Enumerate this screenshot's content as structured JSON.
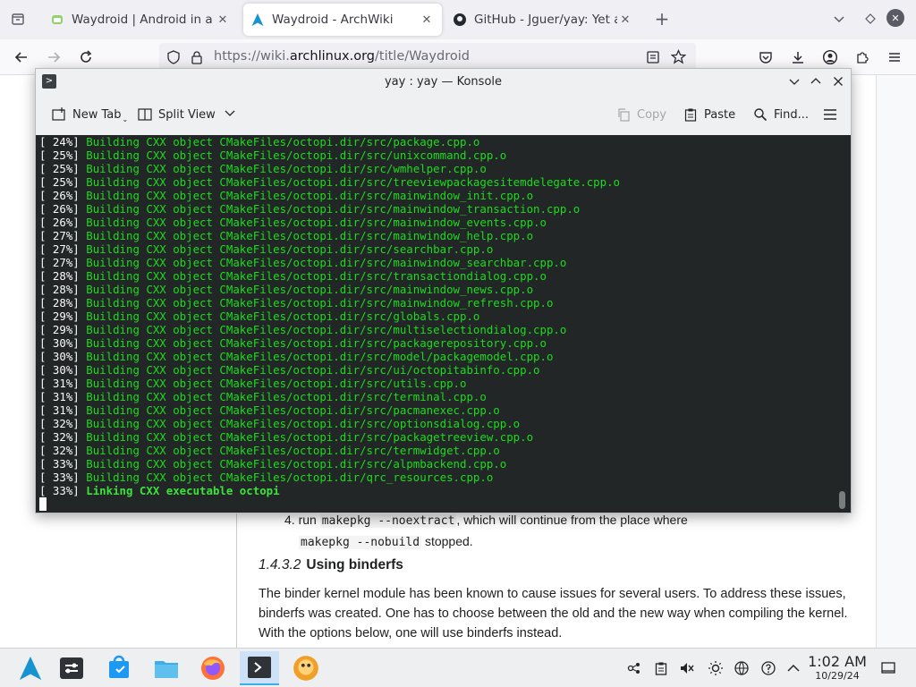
{
  "browser": {
    "tabs": [
      {
        "label": "Waydroid | Android in a Li",
        "icon": "waydroid-favicon",
        "active": false
      },
      {
        "label": "Waydroid - ArchWiki",
        "icon": "archlinux-favicon",
        "active": true
      },
      {
        "label": "GitHub - Jguer/yay: Yet ano",
        "icon": "github-favicon",
        "active": false
      }
    ],
    "url_prefix": "https://wiki.",
    "url_domain": "archlinux.org",
    "url_path": "/title/Waydroid"
  },
  "wiki": {
    "list_item_number": "4.",
    "list_item_run": "run",
    "code_noextract": "makepkg --noextract",
    "list_item_text1": ", which will continue from the place where",
    "code_nobuild": "makepkg --nobuild",
    "list_item_text2": " stopped.",
    "section_number": "1.4.3.2",
    "section_title": "Using binderfs",
    "paragraph": "The binder kernel module has been known to cause issues for several users. To address these issues, binderfs was created. One has to choose between the old and the new way when compiling the kernel. With the options below, one will use binderfs instead."
  },
  "konsole": {
    "title": "yay : yay — Konsole",
    "toolbar": {
      "new_tab": "New Tab",
      "split_view": "Split View",
      "copy": "Copy",
      "paste": "Paste",
      "find": "Find..."
    },
    "lines": [
      {
        "pct": "[ 24%]",
        "msg": "Building CXX object CMakeFiles/octopi.dir/src/package.cpp.o"
      },
      {
        "pct": "[ 25%]",
        "msg": "Building CXX object CMakeFiles/octopi.dir/src/unixcommand.cpp.o"
      },
      {
        "pct": "[ 25%]",
        "msg": "Building CXX object CMakeFiles/octopi.dir/src/wmhelper.cpp.o"
      },
      {
        "pct": "[ 25%]",
        "msg": "Building CXX object CMakeFiles/octopi.dir/src/treeviewpackagesitemdelegate.cpp.o"
      },
      {
        "pct": "[ 26%]",
        "msg": "Building CXX object CMakeFiles/octopi.dir/src/mainwindow_init.cpp.o"
      },
      {
        "pct": "[ 26%]",
        "msg": "Building CXX object CMakeFiles/octopi.dir/src/mainwindow_transaction.cpp.o"
      },
      {
        "pct": "[ 26%]",
        "msg": "Building CXX object CMakeFiles/octopi.dir/src/mainwindow_events.cpp.o"
      },
      {
        "pct": "[ 27%]",
        "msg": "Building CXX object CMakeFiles/octopi.dir/src/mainwindow_help.cpp.o"
      },
      {
        "pct": "[ 27%]",
        "msg": "Building CXX object CMakeFiles/octopi.dir/src/searchbar.cpp.o"
      },
      {
        "pct": "[ 27%]",
        "msg": "Building CXX object CMakeFiles/octopi.dir/src/mainwindow_searchbar.cpp.o"
      },
      {
        "pct": "[ 28%]",
        "msg": "Building CXX object CMakeFiles/octopi.dir/src/transactiondialog.cpp.o"
      },
      {
        "pct": "[ 28%]",
        "msg": "Building CXX object CMakeFiles/octopi.dir/src/mainwindow_news.cpp.o"
      },
      {
        "pct": "[ 28%]",
        "msg": "Building CXX object CMakeFiles/octopi.dir/src/mainwindow_refresh.cpp.o"
      },
      {
        "pct": "[ 29%]",
        "msg": "Building CXX object CMakeFiles/octopi.dir/src/globals.cpp.o"
      },
      {
        "pct": "[ 29%]",
        "msg": "Building CXX object CMakeFiles/octopi.dir/src/multiselectiondialog.cpp.o"
      },
      {
        "pct": "[ 30%]",
        "msg": "Building CXX object CMakeFiles/octopi.dir/src/packagerepository.cpp.o"
      },
      {
        "pct": "[ 30%]",
        "msg": "Building CXX object CMakeFiles/octopi.dir/src/model/packagemodel.cpp.o"
      },
      {
        "pct": "[ 30%]",
        "msg": "Building CXX object CMakeFiles/octopi.dir/src/ui/octopitabinfo.cpp.o"
      },
      {
        "pct": "[ 31%]",
        "msg": "Building CXX object CMakeFiles/octopi.dir/src/utils.cpp.o"
      },
      {
        "pct": "[ 31%]",
        "msg": "Building CXX object CMakeFiles/octopi.dir/src/terminal.cpp.o"
      },
      {
        "pct": "[ 31%]",
        "msg": "Building CXX object CMakeFiles/octopi.dir/src/pacmanexec.cpp.o"
      },
      {
        "pct": "[ 32%]",
        "msg": "Building CXX object CMakeFiles/octopi.dir/src/optionsdialog.cpp.o"
      },
      {
        "pct": "[ 32%]",
        "msg": "Building CXX object CMakeFiles/octopi.dir/src/packagetreeview.cpp.o"
      },
      {
        "pct": "[ 32%]",
        "msg": "Building CXX object CMakeFiles/octopi.dir/src/termwidget.cpp.o"
      },
      {
        "pct": "[ 33%]",
        "msg": "Building CXX object CMakeFiles/octopi.dir/src/alpmbackend.cpp.o"
      },
      {
        "pct": "[ 33%]",
        "msg": "Building CXX object CMakeFiles/octopi.dir/qrc_resources.cpp.o"
      },
      {
        "pct": "[ 33%]",
        "msg": "Linking CXX executable octopi",
        "bold": true
      }
    ]
  },
  "taskbar": {
    "apps": [
      "arch-launcher-icon",
      "system-settings-icon",
      "discover-icon",
      "dolphin-icon",
      "firefox-icon",
      "konsole-icon",
      "octopi-icon"
    ],
    "time": "1:02 AM",
    "date": "10/29/24"
  },
  "colors": {
    "terminal_bg": "#232627",
    "terminal_green": "#1cdc1c",
    "arch_blue": "#1793d1",
    "accent": "#3daee9"
  }
}
